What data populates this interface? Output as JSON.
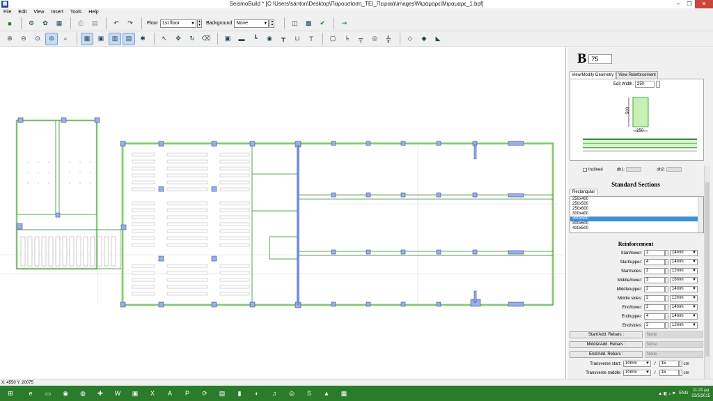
{
  "window": {
    "title": "SeismoBuild * [C:\\Users\\santon\\Desktop\\Παρουσίαση_ΤΕΙ_Πειραιά\\images\\Μιραμαρε\\Μιραμαρε_1.bpf]",
    "app_icon": "building-icon"
  },
  "menu": {
    "file": "File",
    "edit": "Edit",
    "view": "View",
    "insert": "Insert",
    "tools": "Tools",
    "help": "Help"
  },
  "toolbar": {
    "floor_label": "Floor",
    "floor_value": "1st floor",
    "background_label": "Background",
    "background_value": "None"
  },
  "panel": {
    "element_letter": "B",
    "element_number": "75",
    "tabs": {
      "geometry": "View/Modify Geometry",
      "reinforcement": "View Reinforcement"
    },
    "edit_width_label": "Edit Width:",
    "edit_width_value": "250",
    "preview_height": "500",
    "preview_width": "250",
    "inclined_label": "Inclined",
    "dh1_label": "dh1:",
    "dh2_label": "dh2:",
    "standard_sections_title": "Standard Sections",
    "rect_tab": "Rectangular",
    "sections": [
      "250x400",
      "250x500",
      "250x600",
      "300x400",
      "300x500",
      "300x600",
      "400x500"
    ],
    "selected_section": "300x500",
    "reinforcement_title": "Reinforcement",
    "rebars": [
      {
        "label": "Start/lower:",
        "count": "2",
        "dia": "14mm"
      },
      {
        "label": "Start/upper:",
        "count": "4",
        "dia": "14mm"
      },
      {
        "label": "Start/sides:",
        "count": "2",
        "dia": "12mm"
      },
      {
        "label": "Middle/lower:",
        "count": "3",
        "dia": "16mm"
      },
      {
        "label": "Middle/upper:",
        "count": "2",
        "dia": "14mm"
      },
      {
        "label": "Middle sides:",
        "count": "2",
        "dia": "12mm"
      },
      {
        "label": "End/lower:",
        "count": "2",
        "dia": "14mm"
      },
      {
        "label": "End/upper:",
        "count": "4",
        "dia": "14mm"
      },
      {
        "label": "End/sides:",
        "count": "2",
        "dia": "12mm"
      }
    ],
    "add_rebars": [
      {
        "label": "Start/Add. Rebars :",
        "value": "None"
      },
      {
        "label": "Middle/Add. Rebars :",
        "value": "None"
      },
      {
        "label": "End/Add. Rebars :",
        "value": "None"
      }
    ],
    "transverse": [
      {
        "label": "Transverse start:",
        "dia": "10mm",
        "spacing": "15",
        "unit": "cm"
      },
      {
        "label": "Transverse middle:",
        "dia": "10mm",
        "spacing": "15",
        "unit": "cm"
      }
    ]
  },
  "status": {
    "coords": "X: 4550  Y: 20075"
  },
  "taskbar": {
    "lang": "ENG",
    "time": "11:21 μμ",
    "date": "23/5/2015"
  },
  "colors": {
    "beam_fill": "#c6f0b4",
    "beam_stroke": "#2d8a2d",
    "column": "#7b8fd1",
    "selection": "#3f8ed9",
    "taskbar": "#2b7c2a"
  }
}
